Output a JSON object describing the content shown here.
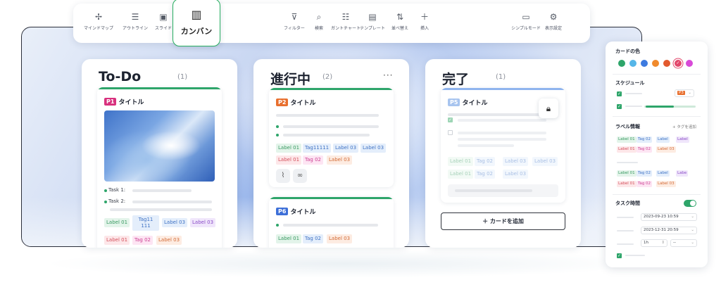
{
  "toolbar": {
    "items_left": [
      {
        "label": "マインドマップ",
        "icon": "mindmap-icon"
      },
      {
        "label": "アウトライン",
        "icon": "outline-icon"
      },
      {
        "label": "スライド",
        "icon": "slide-icon"
      }
    ],
    "active": {
      "label": "カンバン",
      "icon": "kanban-icon"
    },
    "items_center": [
      {
        "label": "フィルター",
        "icon": "filter-icon"
      },
      {
        "label": "検索",
        "icon": "search-icon"
      },
      {
        "label": "ガントチャート",
        "icon": "gantt-icon"
      },
      {
        "label": "テンプレート",
        "icon": "template-icon"
      },
      {
        "label": "並べ替え",
        "icon": "sort-icon"
      },
      {
        "label": "挿入",
        "icon": "plus-icon"
      }
    ],
    "items_right": [
      {
        "label": "シンプルモード",
        "icon": "simple-mode-icon"
      },
      {
        "label": "表示設定",
        "icon": "display-settings-icon"
      }
    ]
  },
  "columns": [
    {
      "title": "To-Do",
      "count": "(1)",
      "card": {
        "priority": "P1",
        "title": "タイトル",
        "tasks": [
          "Task 1:",
          "Task 2:"
        ],
        "tags_row1": [
          "Label 01",
          "Tag11\n111",
          "Label 03",
          "Label 03"
        ],
        "tags_row2": [
          "Label 01",
          "Tag 02",
          "Label 03"
        ]
      }
    },
    {
      "title": "進行中",
      "count": "(2)",
      "more": "···",
      "card1": {
        "priority": "P2",
        "title": "タイトル",
        "tags_row1": [
          "Label 01",
          "Tag11111",
          "Label 03",
          "Label 03"
        ],
        "tags_row2": [
          "Label 01",
          "Tag 02",
          "Label 03"
        ]
      },
      "card2": {
        "priority": "P6",
        "title": "タイトル",
        "tags_row1": [
          "Label 01",
          "Tag 02",
          "Label 03"
        ]
      }
    },
    {
      "title": "完了",
      "count": "(1)",
      "card": {
        "priority": "P5",
        "title": "タイトル",
        "tags_row1": [
          "Label 01",
          "Tag 02",
          "Label 03",
          "Label 03"
        ],
        "tags_row2": [
          "Label 01",
          "Tag 02",
          "Label 03"
        ]
      },
      "add_card": "カードを追加"
    }
  ],
  "panel": {
    "card_color_title": "カードの色",
    "swatches": [
      "#2ea56a",
      "#56b6e8",
      "#3d7be0",
      "#f08a2c",
      "#e25a2e",
      "#e2476b",
      "#d84ad8"
    ],
    "schedule_title": "スケジュール",
    "schedule_priority": "P3",
    "label_title": "ラベル情報",
    "add_tag": "+ タグを追加",
    "tags_a": [
      "Label 01",
      "Tag 02",
      "Label",
      "Label"
    ],
    "tags_b": [
      "Label 01",
      "Tag 02",
      "Label 03"
    ],
    "tags_c": [
      "Label 01",
      "Tag 02",
      "Label",
      "Labe"
    ],
    "tags_d": [
      "Label 01",
      "Tag 02",
      "Label 03"
    ],
    "task_time_title": "タスク時間",
    "date1": "2023-09-23 10:59",
    "date2": "2023-12-31 20:59",
    "duration": "1h",
    "duration2": "--"
  }
}
